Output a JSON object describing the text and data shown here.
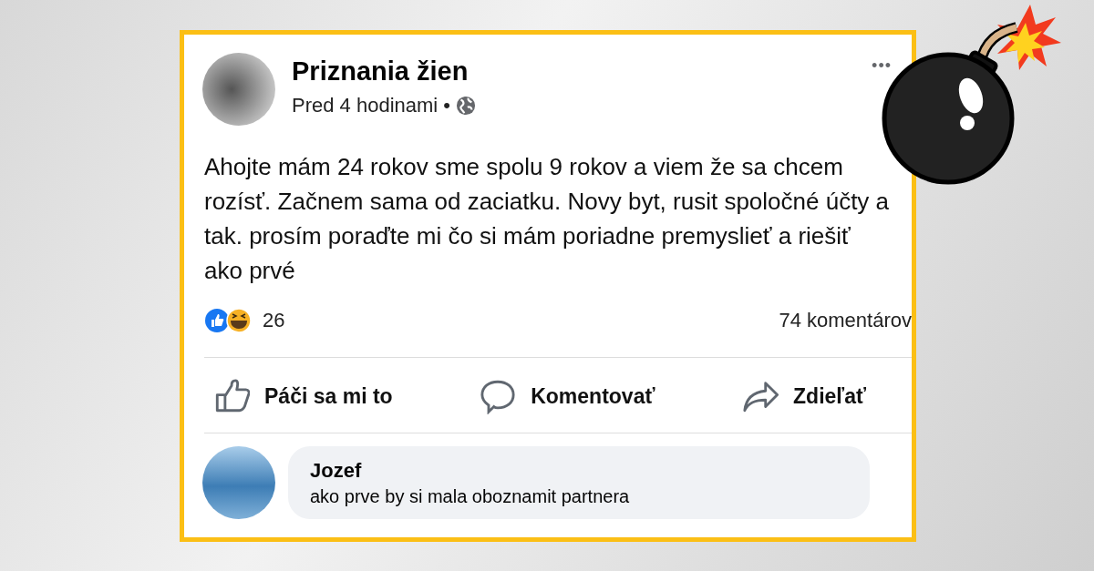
{
  "post": {
    "author": "Priznania žien",
    "time": "Pred 4 hodinami",
    "separator": "•",
    "menu": "•••",
    "text": "Ahojte mám 24 rokov sme spolu 9 rokov a viem že sa chcem rozísť. Začnem sama od zaciatku. Novy byt, rusit spoločné účty a tak. prosím poraďte mi čo si mám poriadne premyslieť a riešiť ako prvé",
    "reaction_count": "26",
    "comment_count": "74 komentárov",
    "actions": [
      {
        "kind": "like",
        "label": "Páči sa mi to"
      },
      {
        "kind": "comment",
        "label": "Komentovať"
      },
      {
        "kind": "share",
        "label": "Zdieľať"
      }
    ]
  },
  "comment": {
    "author": "Jozef",
    "text": "ako prve by si mala oboznamit partnera"
  }
}
